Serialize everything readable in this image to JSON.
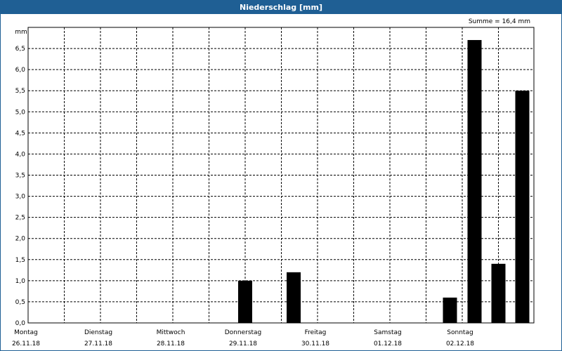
{
  "window": {
    "title": "Niederschlag [mm]"
  },
  "chart_data": {
    "type": "bar",
    "title": "Niederschlag [mm]",
    "ylabel": "mm",
    "ylim": [
      0,
      7.0
    ],
    "yticks": [
      "0,0",
      "0,5",
      "1,0",
      "1,5",
      "2,0",
      "2,5",
      "3,0",
      "3,5",
      "4,0",
      "4,5",
      "5,0",
      "5,5",
      "6,0",
      "6,5"
    ],
    "grid": true,
    "annotation": "Summe = 16,4 mm",
    "days": [
      {
        "day": "Montag",
        "date": "26.11.18"
      },
      {
        "day": "Dienstag",
        "date": "27.11.18"
      },
      {
        "day": "Mittwoch",
        "date": "28.11.18"
      },
      {
        "day": "Donnerstag",
        "date": "29.11.18"
      },
      {
        "day": "Freitag",
        "date": "30.11.18"
      },
      {
        "day": "Samstag",
        "date": "01.12.18"
      },
      {
        "day": "Sonntag",
        "date": "02.12.18"
      }
    ],
    "bars": [
      {
        "t": 3.0,
        "value": 1.0
      },
      {
        "t": 3.67,
        "value": 1.2
      },
      {
        "t": 5.83,
        "value": 0.6
      },
      {
        "t": 6.17,
        "value": 6.7
      },
      {
        "t": 6.5,
        "value": 1.4
      },
      {
        "t": 6.83,
        "value": 5.5
      }
    ]
  }
}
